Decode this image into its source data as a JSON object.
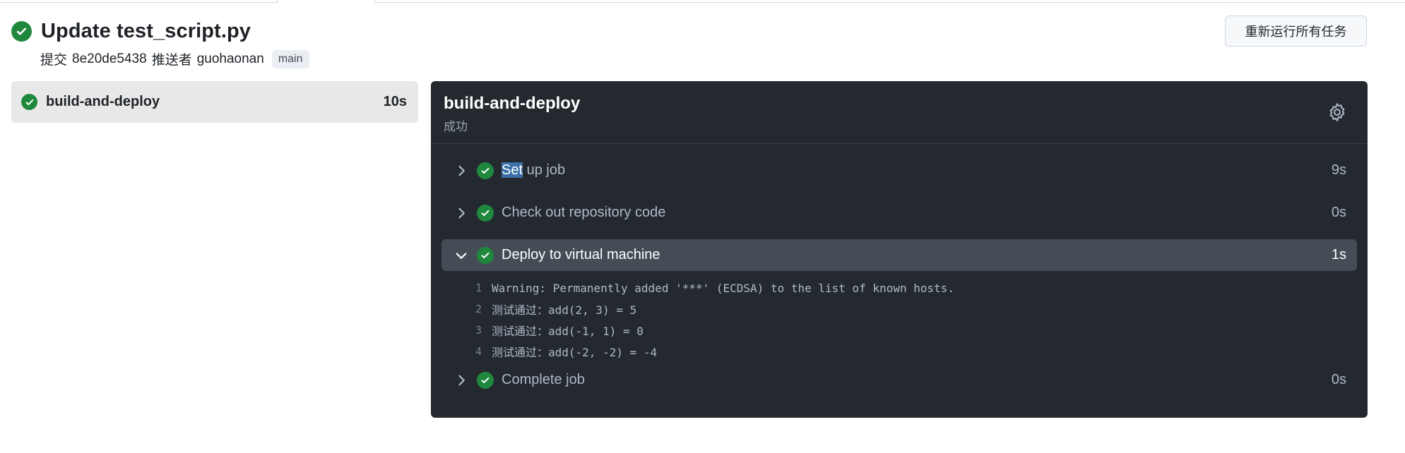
{
  "run": {
    "title": "Update test_script.py",
    "commit_label": "提交",
    "commit_sha": "8e20de5438",
    "pusher_label": "推送者",
    "pusher": "guohaonan",
    "branch": "main",
    "rerun_label": "重新运行所有任务"
  },
  "jobs": [
    {
      "name": "build-and-deploy",
      "duration": "10s",
      "status": "success"
    }
  ],
  "panel": {
    "title": "build-and-deploy",
    "status": "成功",
    "steps": [
      {
        "name_selected": "Set",
        "name_rest": " up job",
        "duration": "9s",
        "expanded": false
      },
      {
        "name": "Check out repository code",
        "duration": "0s",
        "expanded": false
      },
      {
        "name": "Deploy to virtual machine",
        "duration": "1s",
        "expanded": true
      },
      {
        "name": "Complete job",
        "duration": "0s",
        "expanded": false
      }
    ],
    "log": [
      {
        "num": "1",
        "text": "Warning: Permanently added '***' (ECDSA) to the list of known hosts."
      },
      {
        "num": "2",
        "text": "测试通过：add(2, 3) = 5"
      },
      {
        "num": "3",
        "text": "测试通过：add(-1, 1) = 0"
      },
      {
        "num": "4",
        "text": "测试通过：add(-2, -2) = -4"
      }
    ]
  },
  "icons": {
    "status": "check-circle-icon",
    "settings": "gear-icon",
    "collapsed": "chevron-right-icon",
    "expanded": "chevron-down-icon"
  },
  "colors": {
    "success": "#1f883d",
    "panel_bg": "#24292f",
    "expanded_row": "#444c56",
    "selection": "#3b71a8"
  }
}
